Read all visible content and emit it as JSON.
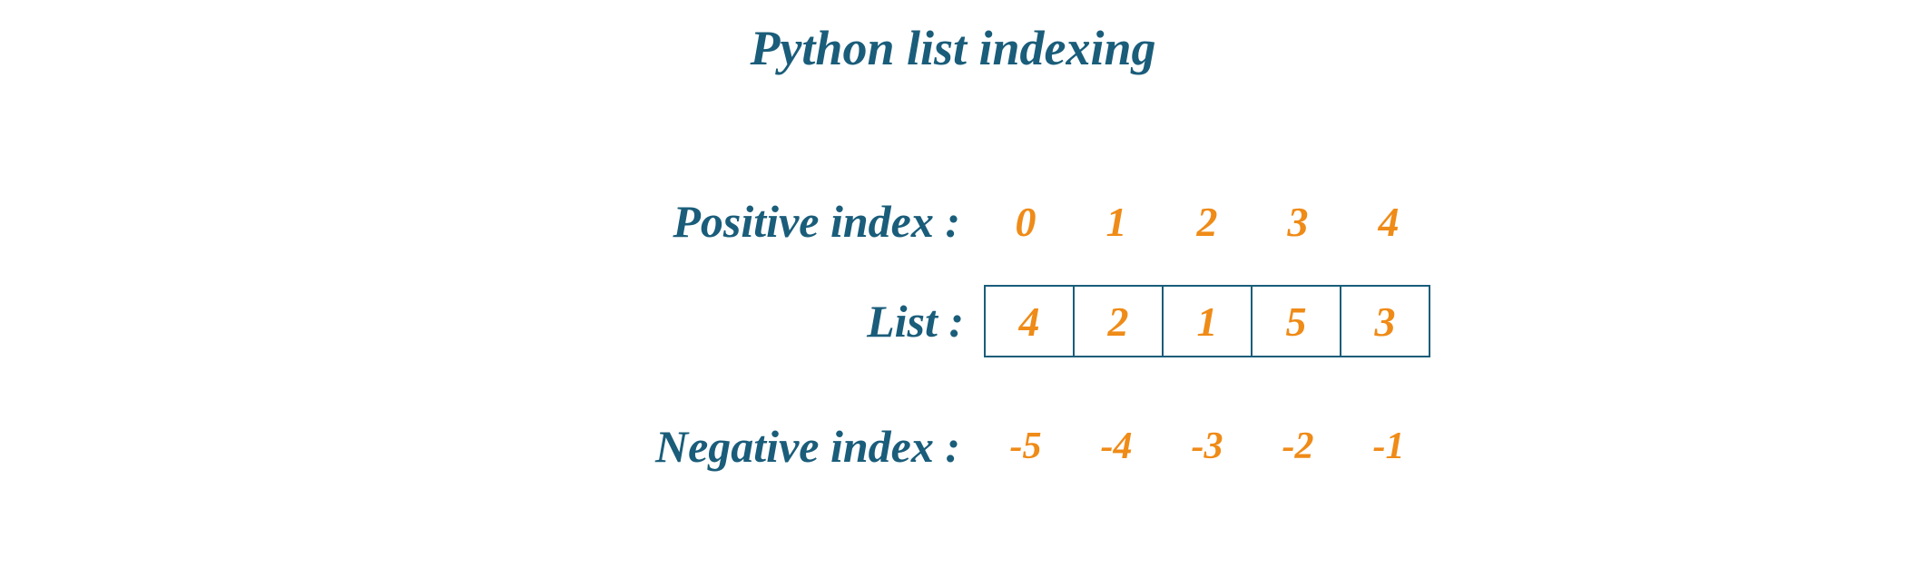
{
  "title": "Python list indexing",
  "labels": {
    "positive": "Positive index :",
    "list": "List :",
    "negative": "Negative index :"
  },
  "positive_index": [
    "0",
    "1",
    "2",
    "3",
    "4"
  ],
  "list_values": [
    "4",
    "2",
    "1",
    "5",
    "3"
  ],
  "negative_index": [
    "-5",
    "-4",
    "-3",
    "-2",
    "-1"
  ]
}
